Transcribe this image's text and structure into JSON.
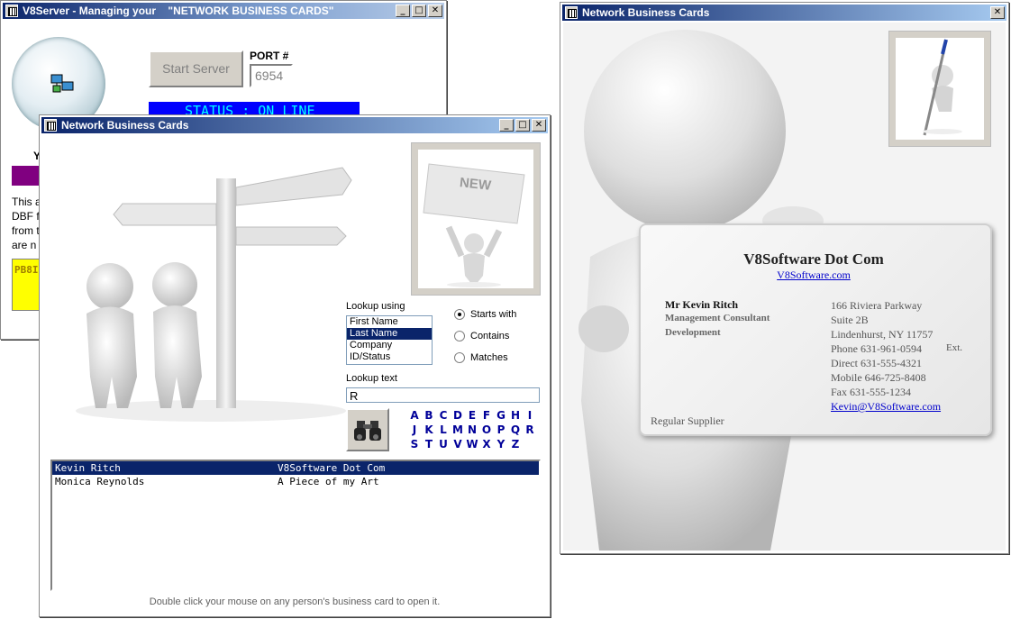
{
  "server_window": {
    "title": "V8Server - Managing your    \"NETWORK BUSINESS CARDS\"",
    "start_server_label": "Start Server",
    "port_label": "PORT #",
    "port_value": "6954",
    "status_text": "STATUS : ON LINE",
    "partial_label_y": "Y",
    "partial_text_lines": [
      "This a",
      "DBF f",
      "from t",
      "are n"
    ],
    "partial_code": "PB8I"
  },
  "lookup_window": {
    "title": "Network Business Cards",
    "new_badge": "NEW",
    "lookup_using_label": "Lookup using",
    "lookup_fields": [
      "First Name",
      "Last Name",
      "Company",
      "ID/Status"
    ],
    "selected_field_index": 1,
    "match_options": [
      "Starts with",
      "Contains",
      "Matches"
    ],
    "selected_match_index": 0,
    "lookup_text_label": "Lookup text",
    "lookup_text_value": "R",
    "letters": [
      [
        "A",
        "B",
        "C",
        "D",
        "E",
        "F",
        "G",
        "H",
        "I"
      ],
      [
        "J",
        "K",
        "L",
        "M",
        "N",
        "O",
        "P",
        "Q",
        "R"
      ],
      [
        "S",
        "T",
        "U",
        "V",
        "W",
        "X",
        "Y",
        "Z"
      ]
    ],
    "results": [
      {
        "name": "Kevin Ritch",
        "company": "V8Software Dot Com",
        "selected": true
      },
      {
        "name": "Monica Reynolds",
        "company": "A Piece of my Art",
        "selected": false
      }
    ],
    "hint": "Double click your mouse on any person's business card to open it."
  },
  "card_window": {
    "title": "Network Business Cards",
    "company": "V8Software Dot Com",
    "website": "V8Software.com",
    "person_name": "Mr Kevin Ritch",
    "person_title": "Management Consultant",
    "department": "Development",
    "address_lines": [
      "166 Riviera Parkway",
      "Suite 2B",
      "Lindenhurst, NY 11757"
    ],
    "phone": "Phone 631-961-0594",
    "ext_label": "Ext.",
    "direct": "Direct 631-555-4321",
    "mobile": "Mobile 646-725-8408",
    "fax": "Fax 631-555-1234",
    "email": "Kevin@V8Software.com",
    "category": "Regular Supplier"
  },
  "colors": {
    "titlebar_dark": "#0a246a",
    "status_bg": "#0000ff",
    "status_text": "#00ffff",
    "purple_bar": "#800080",
    "yellow_box": "#ffff00",
    "letter_color": "#000099"
  }
}
